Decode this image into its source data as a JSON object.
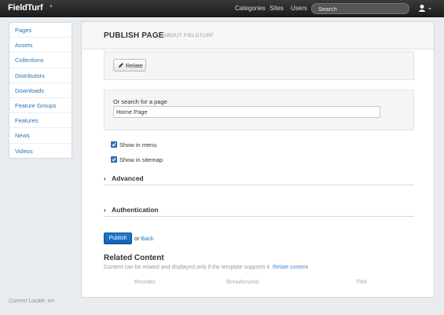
{
  "navbar": {
    "brand": "FieldTurf",
    "links": [
      "Categories",
      "Sites",
      "Users"
    ],
    "search_placeholder": "Search",
    "user_icon": "user-icon"
  },
  "sidebar": {
    "items": [
      {
        "label": "Pages"
      },
      {
        "label": "Assets"
      },
      {
        "label": "Collections"
      },
      {
        "label": "Distributors"
      },
      {
        "label": "Downloads"
      },
      {
        "label": "Feature Groups"
      },
      {
        "label": "Features"
      },
      {
        "label": "News"
      },
      {
        "label": "Videos"
      }
    ]
  },
  "footer": {
    "locale": "Current Locale: en"
  },
  "header": {
    "title": "PUBLISH PAGE",
    "subtitle": "ABOUT FIELDTURF"
  },
  "relate": {
    "button_label": "Relate",
    "icon": "pencil-icon"
  },
  "search_page": {
    "label": "Or search for a page",
    "value": "Home Page"
  },
  "options": {
    "show_in_menu": {
      "label": "Show in menu",
      "checked": true
    },
    "show_in_sitemap": {
      "label": "Show in sitemap",
      "checked": true
    }
  },
  "sections": {
    "advanced": "Advanced",
    "authentication": "Authentication"
  },
  "actions": {
    "publish": "Publish",
    "or": "or",
    "back": "Back"
  },
  "related": {
    "title": "Related Content",
    "description": "Content can be related and displayed only if the template supports it.",
    "link": "Relate content",
    "columns": [
      "Reorder",
      "Breadcrumb",
      "Title"
    ]
  },
  "colors": {
    "link": "#2a75b6",
    "primary_button": "#1a6ec4",
    "navbar": "#2b2b2b",
    "checkbox": "#3b78c6"
  }
}
